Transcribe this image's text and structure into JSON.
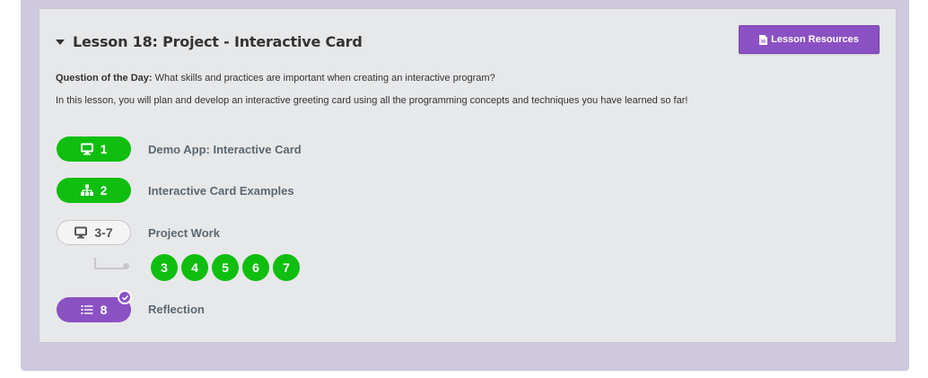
{
  "lesson": {
    "title": "Lesson 18: Project - Interactive Card",
    "resources_label": "Lesson Resources",
    "qotd_label": "Question of the Day:",
    "qotd_text": " What skills and practices are important when creating an interactive program?",
    "description": "In this lesson, you will plan and develop an interactive greeting card using all the programming concepts and techniques you have learned so far!"
  },
  "activities": [
    {
      "number": "1",
      "label": "Demo App: Interactive Card",
      "icon": "desktop-icon",
      "style": "green"
    },
    {
      "number": "2",
      "label": "Interactive Card Examples",
      "icon": "sitemap-icon",
      "style": "green"
    },
    {
      "number": "3-7",
      "label": "Project Work",
      "icon": "desktop-icon",
      "style": "outline"
    },
    {
      "number": "8",
      "label": "Reflection",
      "icon": "list-icon",
      "style": "purple",
      "completed": true
    }
  ],
  "sublevels": [
    "3",
    "4",
    "5",
    "6",
    "7"
  ],
  "colors": {
    "green": "#0fbe0f",
    "purple": "#8a51c3",
    "panel": "#e7e8ea",
    "outer": "#cfc9df"
  }
}
